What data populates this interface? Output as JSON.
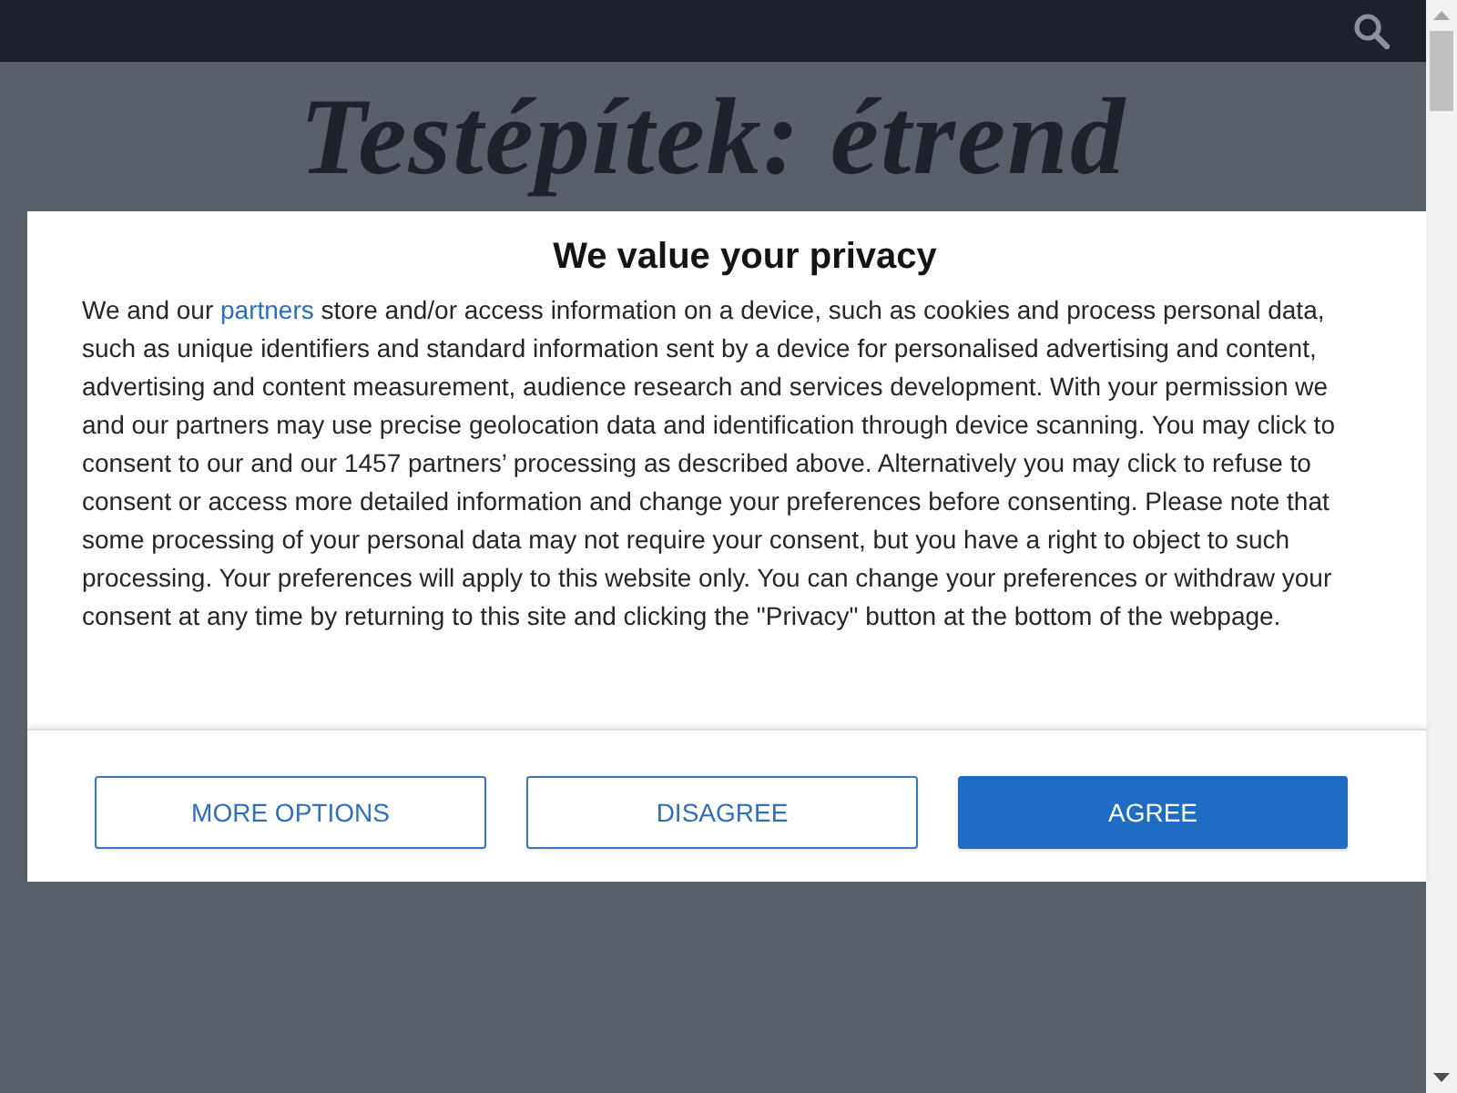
{
  "page": {
    "heading": "Testépítek: étrend"
  },
  "consent_dialog": {
    "title": "We value your privacy",
    "text_before_link": "We and our ",
    "link": "partners",
    "text_after_link": " store and/or access information on a device, such as cookies and process personal data, such as unique identifiers and standard information sent by a device for personalised advertising and content, advertising and content measurement, audience research and services development. With your permission we and our partners may use precise geolocation data and identification through device scanning. You may click to consent to our and our 1457 partners’ processing as described above. Alternatively you may click to refuse to consent or access more detailed information and change your preferences before consenting. Please note that some processing of your personal data may not require your consent, but you have a right to object to such processing. Your preferences will apply to this website only. You can change your preferences or withdraw your consent at any time by returning to this site and clicking the \"Privacy\" button at the bottom of the webpage.",
    "buttons": [
      {
        "label": "MORE OPTIONS",
        "kind": "outline"
      },
      {
        "label": "DISAGREE",
        "kind": "outline"
      },
      {
        "label": "AGREE",
        "kind": "primary"
      }
    ]
  }
}
